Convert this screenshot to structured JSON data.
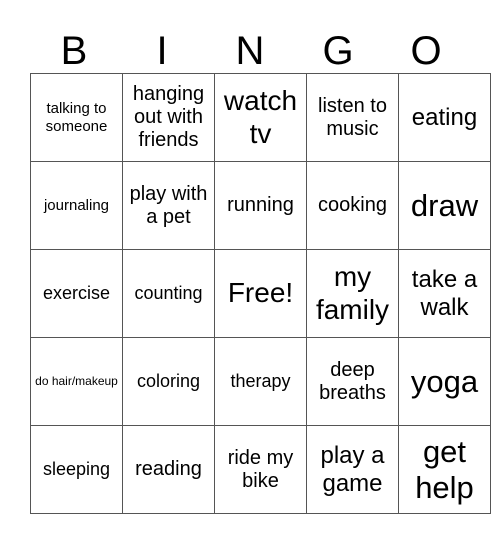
{
  "header": [
    "B",
    "I",
    "N",
    "G",
    "O"
  ],
  "rows": [
    [
      "talking to someone",
      "hanging out with friends",
      "watch tv",
      "listen to music",
      "eating"
    ],
    [
      "journaling",
      "play with a pet",
      "running",
      "cooking",
      "draw"
    ],
    [
      "exercise",
      "counting",
      "Free!",
      "my family",
      "take a walk"
    ],
    [
      "do hair/makeup",
      "coloring",
      "therapy",
      "deep breaths",
      "yoga"
    ],
    [
      "sleeping",
      "reading",
      "ride my bike",
      "play a game",
      "get help"
    ]
  ]
}
